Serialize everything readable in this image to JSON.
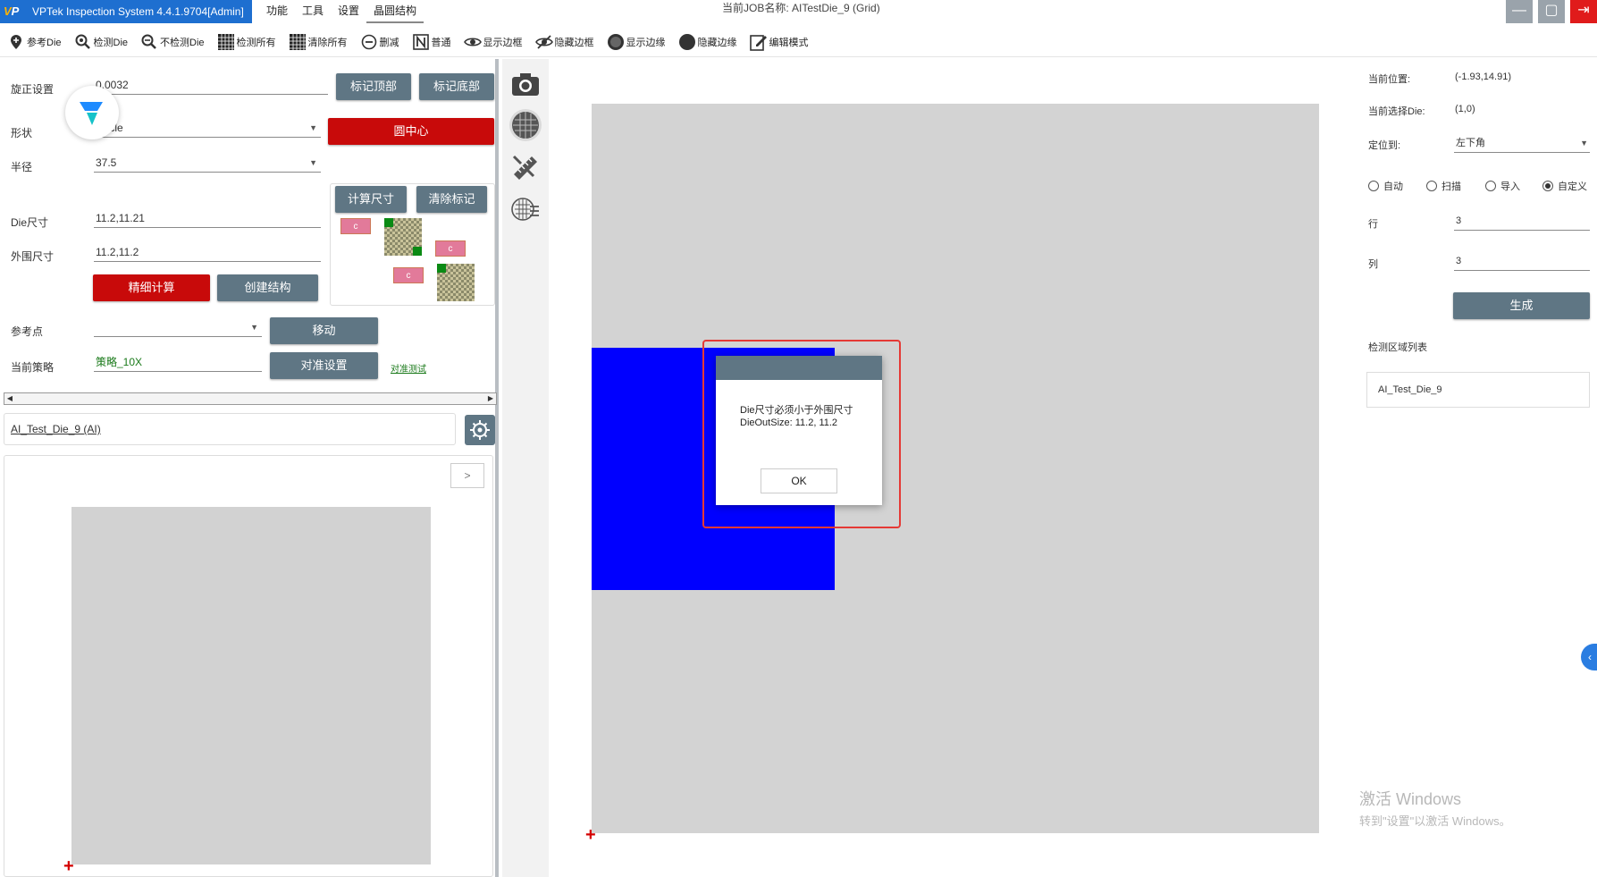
{
  "app": {
    "title": "VPTek Inspection System 4.4.1.9704[Admin]",
    "logo_text": "VP",
    "menu": [
      "功能",
      "工具",
      "设置",
      "晶圆结构"
    ],
    "job_name": "当前JOB名称:  AITestDie_9 (Grid)",
    "window_buttons": [
      "—",
      "▢",
      "⇥"
    ]
  },
  "toolbar": [
    {
      "label": "参考Die",
      "icon": "pin-icon"
    },
    {
      "label": "检测Die",
      "icon": "magnifier-icon"
    },
    {
      "label": "不检测Die",
      "icon": "magnifier-icon"
    },
    {
      "label": "检测所有",
      "icon": "grid-icon"
    },
    {
      "label": "清除所有",
      "icon": "grid-icon"
    },
    {
      "label": "删减",
      "icon": "minus-circle-icon"
    },
    {
      "label": "普通",
      "icon": "n-box-icon"
    },
    {
      "label": "显示边框",
      "icon": "eye-icon"
    },
    {
      "label": "隐藏边框",
      "icon": "eye-off-icon"
    },
    {
      "label": "显示边缘",
      "icon": "circle-dark-icon"
    },
    {
      "label": "隐藏边缘",
      "icon": "circle-filled-icon"
    },
    {
      "label": "编辑模式",
      "icon": "edit-icon"
    }
  ],
  "left": {
    "rotation_label": "旋正设置",
    "rotation_value": "0.0032",
    "mark_top": "标记顶部",
    "mark_bottom": "标记底部",
    "shape_label": "形状",
    "shape_value": "Circle",
    "circle_center": "圆中心",
    "radius_label": "半径",
    "radius_value": "37.5",
    "calc_size": "计算尺寸",
    "clear_mark": "清除标记",
    "die_size_label": "Die尺寸",
    "die_size_value": "11.2,11.21",
    "outer_size_label": "外围尺寸",
    "outer_size_value": "11.2,11.2",
    "fine_calc": "精细计算",
    "create_struct": "创建结构",
    "ref_point_label": "参考点",
    "ref_point_value": "",
    "move": "移动",
    "strategy_label": "当前策略",
    "strategy_value": "策略_10X",
    "align_settings": "对准设置",
    "align_test": "对准测试",
    "diagram_c": "c",
    "job_item": "AI_Test_Die_9 (AI)",
    "preview_next": ">"
  },
  "dialog": {
    "line1": "Die尺寸必须小于外围尺寸",
    "line2": "DieOutSize: 11.2, 11.2",
    "ok": "OK"
  },
  "right": {
    "pos_label": "当前位置:",
    "pos_value": "(-1.93,14.91)",
    "die_label": "当前选择Die:",
    "die_value": "(1,0)",
    "locate_label": "定位到:",
    "locate_value": "左下角",
    "radios": [
      {
        "label": "自动",
        "checked": false
      },
      {
        "label": "扫描",
        "checked": false
      },
      {
        "label": "导入",
        "checked": false
      },
      {
        "label": "自定义",
        "checked": true
      }
    ],
    "row_label": "行",
    "row_value": "3",
    "col_label": "列",
    "col_value": "3",
    "generate": "生成",
    "area_list_label": "检测区域列表",
    "area_list_item": "AI_Test_Die_9"
  },
  "watermark": {
    "line1": "激活 Windows",
    "line2": "转到\"设置\"以激活 Windows。"
  },
  "colors": {
    "title_blue": "#1e6fd0",
    "button_gray": "#5f7684",
    "button_red": "#c80a0a",
    "die_blue": "#0000ff",
    "grid_gray": "#d3d3d3",
    "highlight_red": "#e53935"
  }
}
